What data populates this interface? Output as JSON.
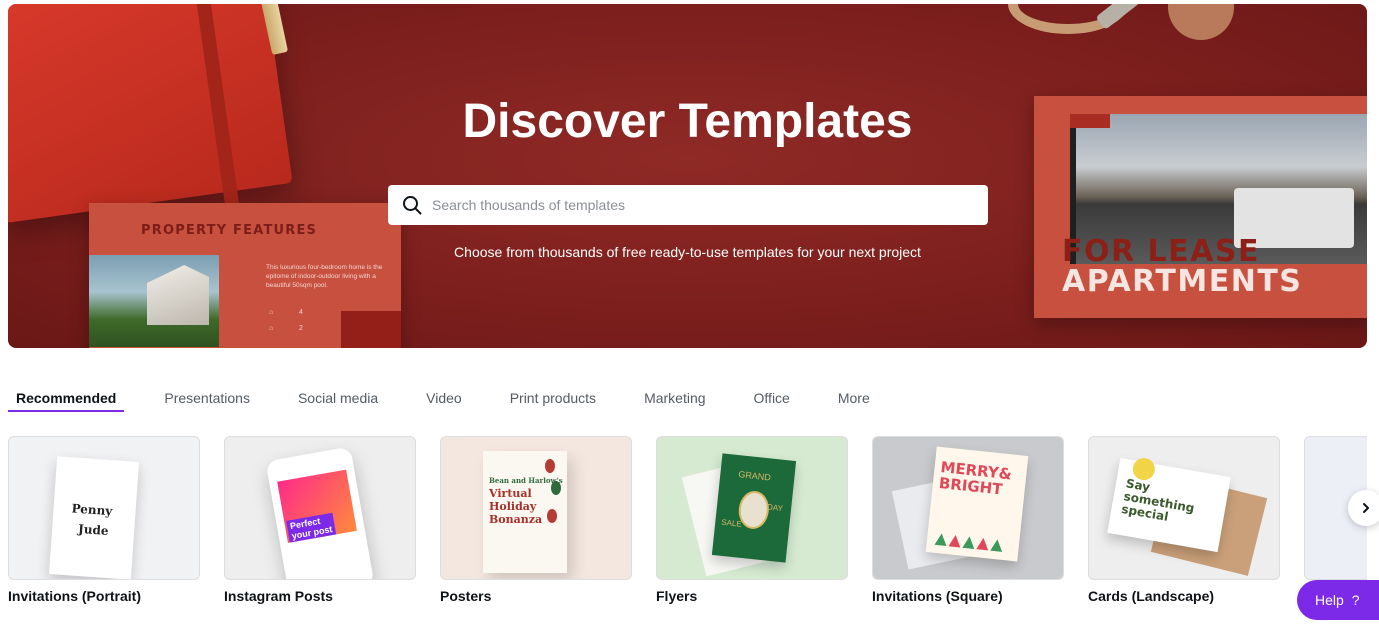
{
  "hero": {
    "title": "Discover Templates",
    "search_placeholder": "Search thousands of templates",
    "subtitle": "Choose from thousands of free ready-to-use templates for your next project",
    "background_color": "#7d1f1d",
    "left_card": {
      "title": "PROPERTY FEATURES",
      "description": "This luxurious four-bedroom home is the epitome of indoor-outdoor living with a beautiful 50sqm pool.",
      "stat1": "4",
      "stat2": "2"
    },
    "right_card": {
      "line1": "FOR LEASE",
      "line2": "APARTMENTS"
    }
  },
  "tabs": [
    {
      "label": "Recommended",
      "active": true
    },
    {
      "label": "Presentations",
      "active": false
    },
    {
      "label": "Social media",
      "active": false
    },
    {
      "label": "Video",
      "active": false
    },
    {
      "label": "Print products",
      "active": false
    },
    {
      "label": "Marketing",
      "active": false
    },
    {
      "label": "Office",
      "active": false
    },
    {
      "label": "More",
      "active": false
    }
  ],
  "categories": [
    {
      "label": "Invitations (Portrait)",
      "thumb_text": [
        "Penny",
        "Jude"
      ]
    },
    {
      "label": "Instagram Posts",
      "thumb_text": [
        "Perfect",
        "your post"
      ]
    },
    {
      "label": "Posters",
      "thumb_text": [
        "Bean and Harlow's",
        "Virtual Holiday Bonanza"
      ]
    },
    {
      "label": "Flyers",
      "thumb_text": [
        "GRAND",
        "DAY",
        "SALE"
      ]
    },
    {
      "label": "Invitations (Square)",
      "thumb_text": [
        "MERRY&",
        "BRIGHT"
      ]
    },
    {
      "label": "Cards (Landscape)",
      "thumb_text": [
        "Say something special"
      ]
    }
  ],
  "controls": {
    "next_icon": "chevron-right-icon",
    "help_label": "Help",
    "help_icon": "?"
  },
  "colors": {
    "accent": "#7d2ae8"
  }
}
